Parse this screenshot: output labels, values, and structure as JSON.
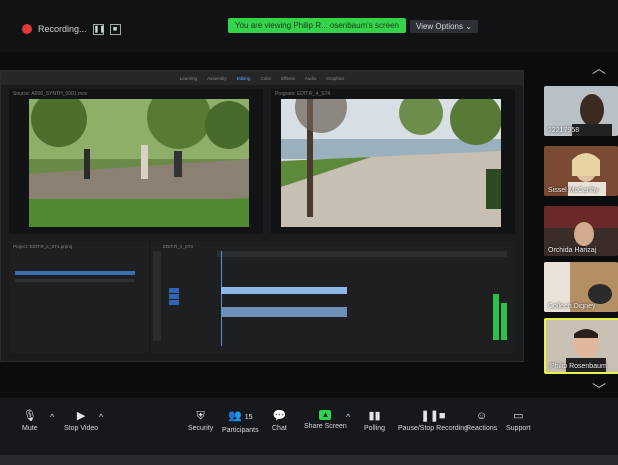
{
  "top": {
    "recording_label": "Recording...",
    "viewing_text": "You are viewing Philip R... osenbaum's screen",
    "view_options": "View Options",
    "pause_icon": "pause-icon",
    "stop_icon": "stop-icon"
  },
  "premiere": {
    "workspace_tabs": [
      "Learning",
      "Assembly",
      "Editing",
      "Color",
      "Effects",
      "Audio",
      "Graphics"
    ],
    "source_label": "Source: A006_SYNTH_0001.mov",
    "program_label": "Program: EDIT.R_4_ST4",
    "project_label": "Project: EDIT.R_4_ST4.prproj",
    "timeline_label": "EDIT.R_4_ST4"
  },
  "participants": [
    {
      "name": "12217958",
      "icon": "participant-video"
    },
    {
      "name": "Sissel McCarthy",
      "icon": "participant-video"
    },
    {
      "name": "Orchida Harizaj",
      "icon": "participant-video"
    },
    {
      "name": "Colleen Digney",
      "icon": "participant-video"
    },
    {
      "name": "Philip Rosenbaum",
      "icon": "participant-video"
    }
  ],
  "toolbar": {
    "mute": "Mute",
    "stop_video": "Stop Video",
    "security": "Security",
    "participants": "Participants",
    "participants_count": "15",
    "chat": "Chat",
    "share_screen": "Share Screen",
    "polling": "Polling",
    "pause_stop_recording": "Pause/Stop Recording",
    "reactions": "Reactions",
    "support": "Support"
  },
  "colors": {
    "accent_green": "#34d34a",
    "record_red": "#e23b3b",
    "active_speaker": "#e7f34a"
  }
}
